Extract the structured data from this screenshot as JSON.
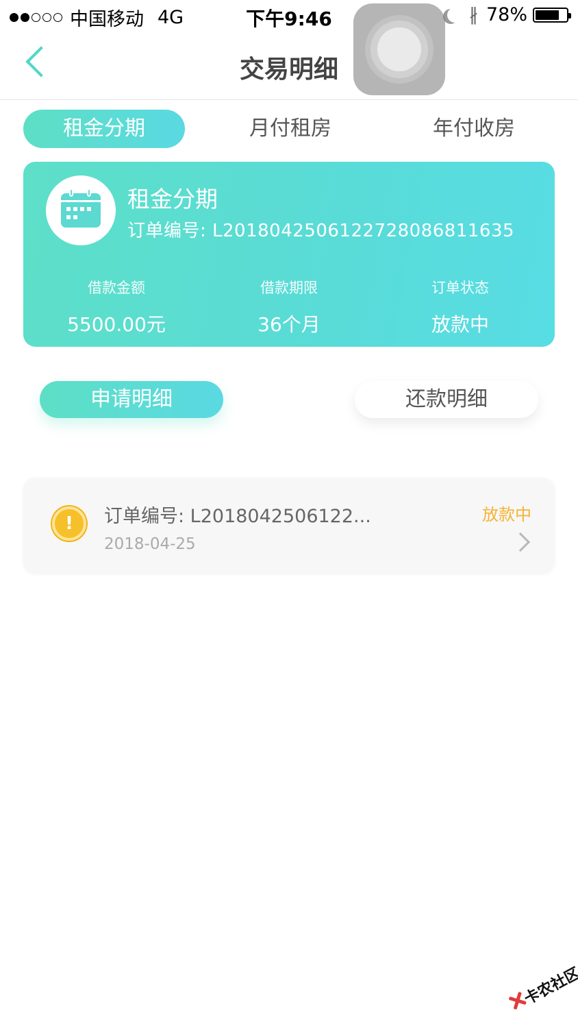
{
  "status_bar": {
    "carrier": "中国移动",
    "network": "4G",
    "time": "下午9:46",
    "battery": "78%",
    "battery_level": 0.78
  },
  "nav": {
    "title": "交易明细",
    "back_icon": "chevron-left-icon"
  },
  "product_tabs": [
    {
      "label": "租金分期",
      "active": true
    },
    {
      "label": "月付租房",
      "active": false
    },
    {
      "label": "年付收房",
      "active": false
    }
  ],
  "summary_card": {
    "icon": "calendar-icon",
    "title": "租金分期",
    "order_label": "订单编号: L20180425061227280868116​35",
    "stats": [
      {
        "label": "借款金额",
        "value": "5500.00元"
      },
      {
        "label": "借款期限",
        "value": "36个月"
      },
      {
        "label": "订单状态",
        "value": "放款中"
      }
    ]
  },
  "detail_tabs": {
    "apply": "申请明细",
    "repay": "还款明细"
  },
  "records": [
    {
      "order": "订单编号: L2018042506122...",
      "date": "2018-04-25",
      "status": "放款中",
      "status_color": "#f5b332",
      "icon": "warning-icon"
    }
  ],
  "colors": {
    "accent": "#5ddfc8",
    "accent_end": "#57dde4",
    "status_pending": "#f5b332"
  },
  "watermark": {
    "text": "卡农社区"
  }
}
